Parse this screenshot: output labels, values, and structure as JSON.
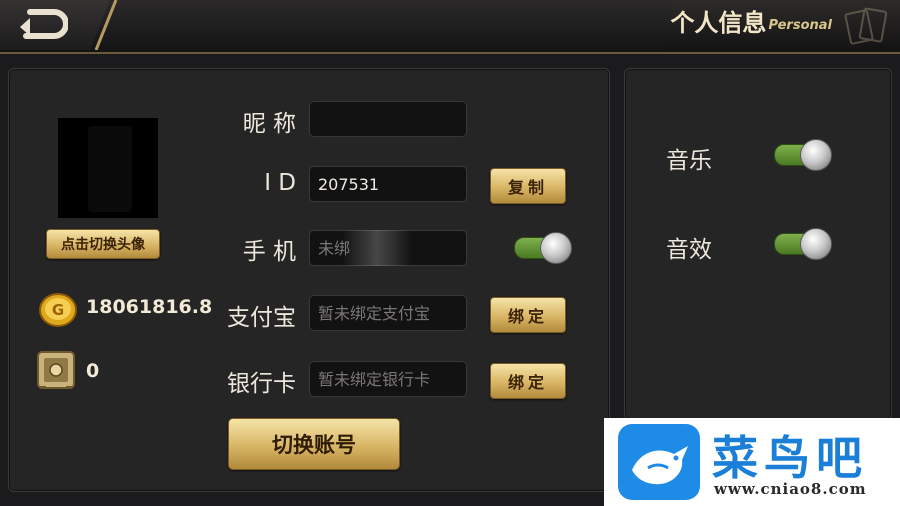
{
  "header": {
    "title_cn": "个人信息",
    "title_en": "Personal"
  },
  "profile": {
    "switch_avatar_label": "点击切换头像",
    "coins": "18061816.8",
    "safe_balance": "0"
  },
  "fields": {
    "nickname_label": "昵 称",
    "nickname_value": "",
    "id_label": "I D",
    "id_value": "207531",
    "copy_label": "复制",
    "phone_label": "手 机",
    "phone_value": "未绑",
    "alipay_label": "支付宝",
    "alipay_placeholder": "暂未绑定支付宝",
    "alipay_bind_label": "绑定",
    "bank_label": "银行卡",
    "bank_placeholder": "暂未绑定银行卡",
    "bank_bind_label": "绑定",
    "switch_account_label": "切换账号"
  },
  "settings": {
    "music_label": "音乐",
    "music_on": true,
    "sfx_label": "音效",
    "sfx_on": true
  },
  "watermark": {
    "brand": "菜鸟吧",
    "url": "www.cniao8.com"
  },
  "colors": {
    "gold_accent": "#d8b565",
    "toggle_on": "#6a9c39",
    "watermark_blue": "#1e8be6"
  }
}
